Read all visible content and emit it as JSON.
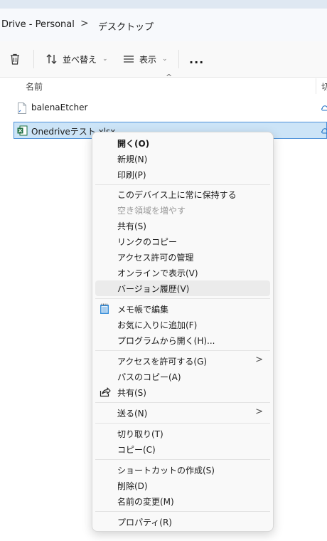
{
  "address": {
    "crumb1": "Drive - Personal",
    "sep": ">",
    "crumb2": "デスクトップ"
  },
  "toolbar": {
    "sort_label": "並べ替え",
    "view_label": "表示",
    "more_label": "..."
  },
  "header": {
    "name_col": "名前",
    "sort_arrow": "^",
    "next_col": "切"
  },
  "files": [
    {
      "name": "balenaEtcher"
    },
    {
      "name": "Onedriveテスト.xlsx"
    }
  ],
  "menu": {
    "open": "開く(O)",
    "new": "新規(N)",
    "print": "印刷(P)",
    "keep_on_device": "このデバイス上に常に保持する",
    "free_space": "空き領域を増やす",
    "share1": "共有(S)",
    "copy_link": "リンクのコピー",
    "manage_access": "アクセス許可の管理",
    "view_online": "オンラインで表示(V)",
    "version_history": "バージョン履歴(V)",
    "notepad_edit": "メモ帳で編集",
    "add_favorites": "お気に入りに追加(F)",
    "open_with": "プログラムから開く(H)...",
    "give_access": "アクセスを許可する(G)",
    "copy_path": "パスのコピー(A)",
    "share2": "共有(S)",
    "send_to": "送る(N)",
    "cut": "切り取り(T)",
    "copy": "コピー(C)",
    "create_shortcut": "ショートカットの作成(S)",
    "delete": "削除(D)",
    "rename": "名前の変更(M)",
    "properties": "プロパティ(R)",
    "submenu_arrow": ">"
  }
}
